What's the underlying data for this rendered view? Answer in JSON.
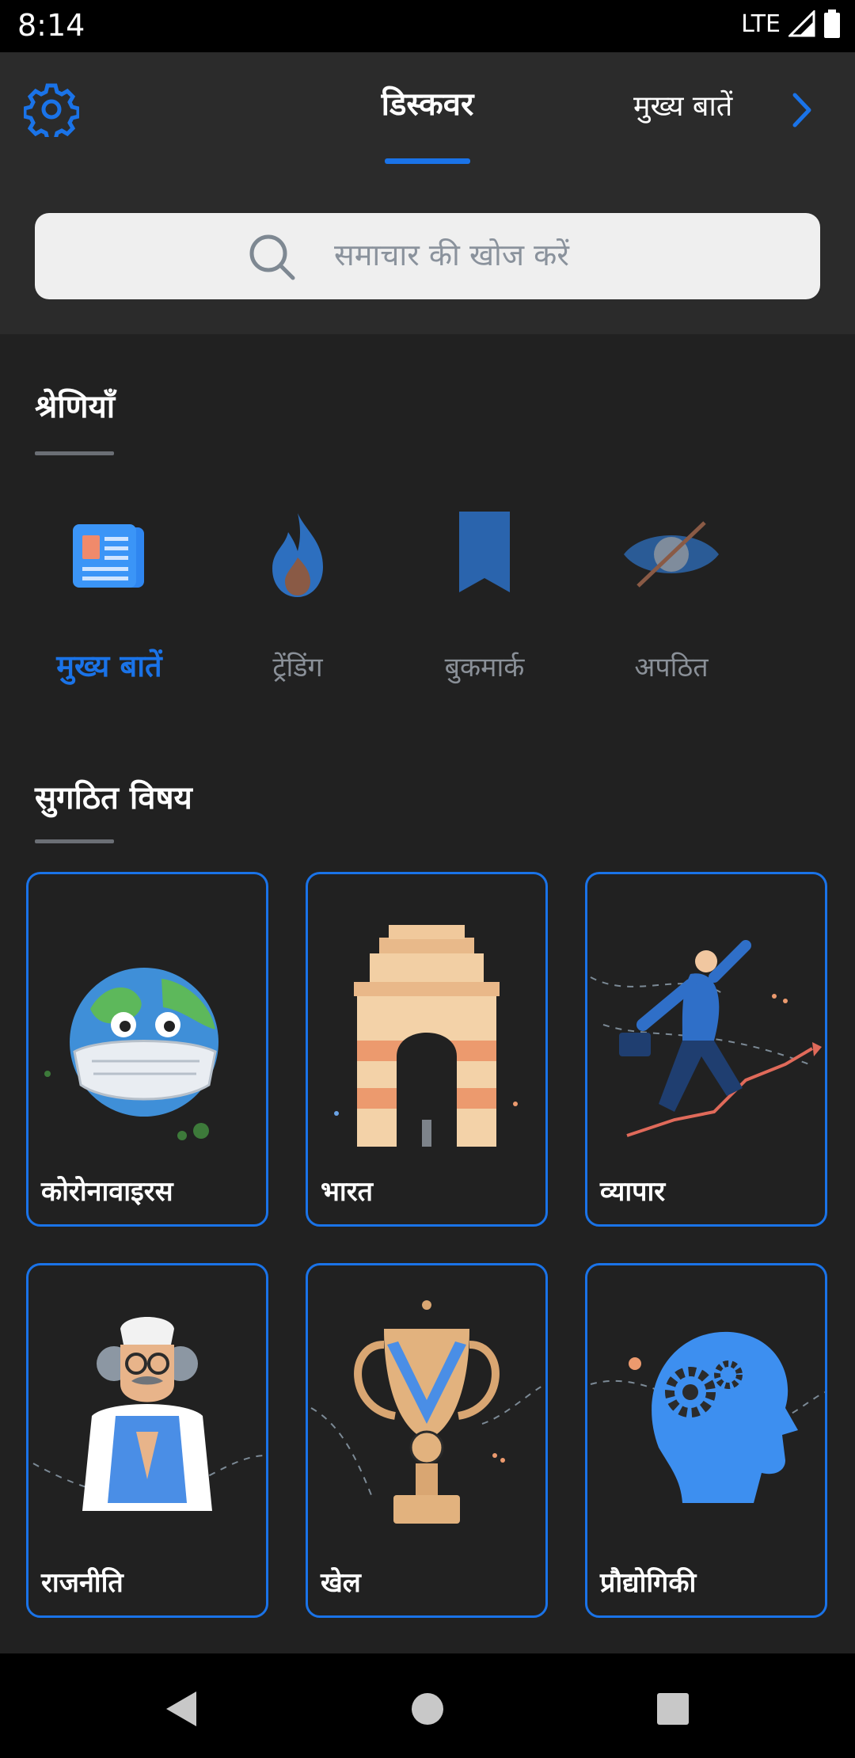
{
  "status_bar": {
    "time": "8:14",
    "network": "LTE"
  },
  "header": {
    "tab_discover": "डिस्कवर",
    "tab_headlines": "मुख्य बातें",
    "accent_color": "#1a73e8"
  },
  "search": {
    "placeholder": "समाचार की खोज करें"
  },
  "categories": {
    "title": "श्रेणियाँ",
    "items": [
      {
        "label": "मुख्य बातें",
        "icon": "newspaper-icon",
        "active": true
      },
      {
        "label": "ट्रेंडिंग",
        "icon": "flame-icon",
        "active": false
      },
      {
        "label": "बुकमार्क",
        "icon": "bookmark-icon",
        "active": false
      },
      {
        "label": "अपठित",
        "icon": "eye-off-icon",
        "active": false
      }
    ]
  },
  "topics": {
    "title": "सुगठित विषय",
    "items": [
      {
        "label": "कोरोनावाइरस",
        "art": "masked-globe"
      },
      {
        "label": "भारत",
        "art": "india-gate"
      },
      {
        "label": "व्यापार",
        "art": "businessman-graph"
      },
      {
        "label": "राजनीति",
        "art": "politician"
      },
      {
        "label": "खेल",
        "art": "trophy"
      },
      {
        "label": "प्रौद्योगिकी",
        "art": "head-gears"
      }
    ]
  }
}
